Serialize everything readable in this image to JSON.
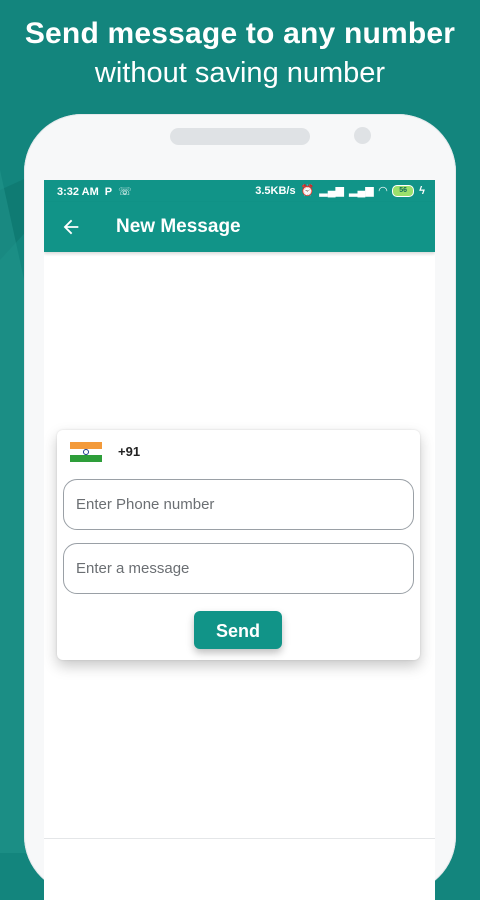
{
  "promo": {
    "line1": "Send message to any number",
    "line2": "without saving number"
  },
  "colors": {
    "background": "#13857d",
    "accent": "#119488",
    "white": "#ffffff"
  },
  "statusbar": {
    "time": "3:32 AM",
    "speed": "3.5KB/s",
    "battery": "56"
  },
  "appbar": {
    "title": "New Message",
    "back_icon": "arrow-left-icon"
  },
  "form": {
    "country_code": "+91",
    "flag_icon": "india-flag-icon",
    "phone_placeholder": "Enter Phone number",
    "phone_value": "",
    "message_placeholder": "Enter a message",
    "message_value": "",
    "send_label": "Send"
  }
}
